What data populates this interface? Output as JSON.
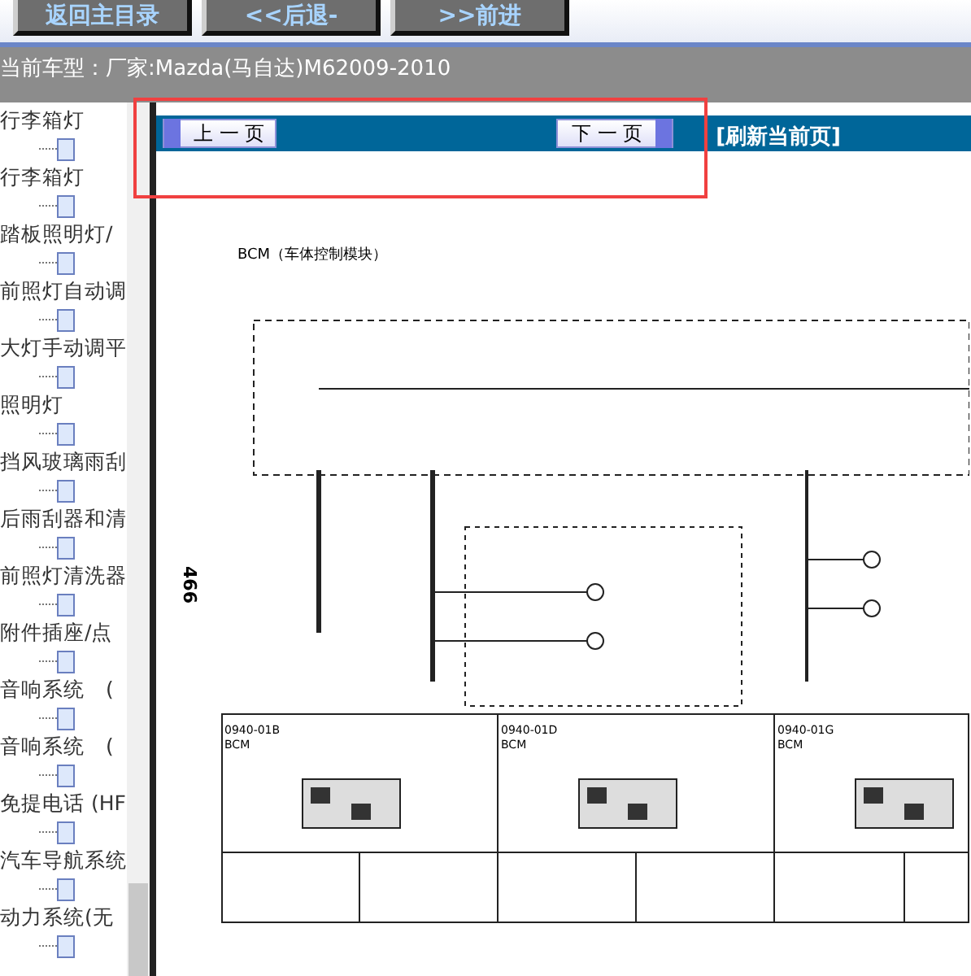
{
  "nav_buttons": [
    {
      "label": "返回主目录"
    },
    {
      "label": "<<后退-"
    },
    {
      "label": ">>前进"
    }
  ],
  "car_type": {
    "label": "当前车型：",
    "value": "厂家:Mazda(马自达)M62009-2010"
  },
  "sidebar": {
    "items": [
      {
        "label": "行李箱灯"
      },
      {
        "label": "行李箱灯"
      },
      {
        "label": "踏板照明灯/"
      },
      {
        "label": "前照灯自动调"
      },
      {
        "label": "大灯手动调平"
      },
      {
        "label": "照明灯"
      },
      {
        "label": "挡风玻璃雨刮"
      },
      {
        "label": "后雨刮器和清"
      },
      {
        "label": "前照灯清洗器"
      },
      {
        "label": "附件插座/点"
      },
      {
        "label": "音响系统　("
      },
      {
        "label": "音响系统　("
      },
      {
        "label": "免提电话 (HF"
      },
      {
        "label": "汽车导航系统"
      },
      {
        "label": "动力系统(无"
      }
    ]
  },
  "toolbar": {
    "prev": "上 一 页",
    "next": "下 一 页",
    "refresh": "[刷新当前页]"
  },
  "diagram": {
    "title": "BCM（车体控制模块）",
    "page_number": "466",
    "connectors": [
      {
        "code": "0940-01B",
        "name": "BCM"
      },
      {
        "code": "0940-01D",
        "name": "BCM"
      },
      {
        "code": "0940-01G",
        "name": "BCM"
      }
    ]
  }
}
